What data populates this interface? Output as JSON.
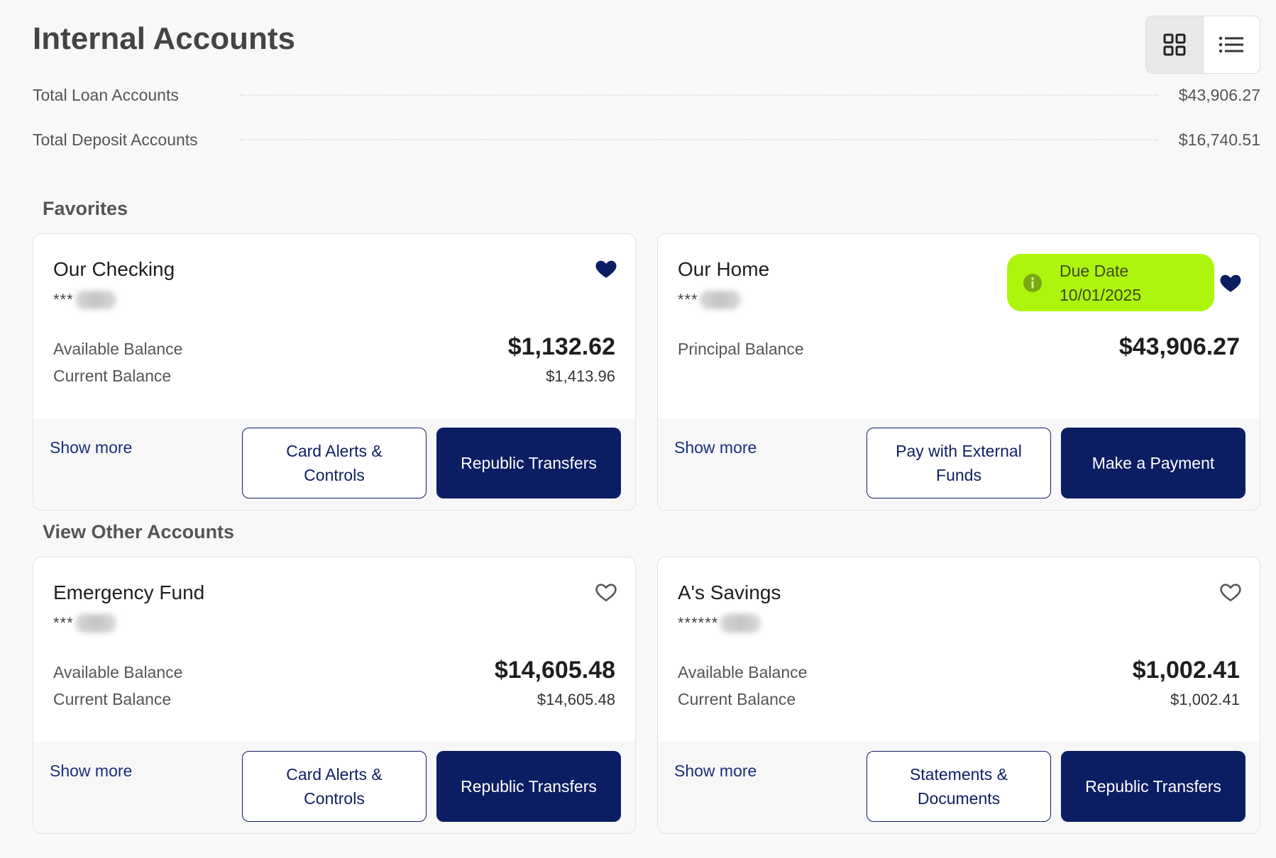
{
  "page": {
    "title": "Internal Accounts"
  },
  "view_toggle": {
    "grid_icon": "grid-icon",
    "list_icon": "list-icon",
    "active": "grid"
  },
  "summary": {
    "loan_label": "Total Loan Accounts",
    "loan_value": "$43,906.27",
    "deposit_label": "Total Deposit Accounts",
    "deposit_value": "$16,740.51"
  },
  "favorites": {
    "title": "Favorites",
    "cards": [
      {
        "name": "Our Checking",
        "mask": "***",
        "favorite": true,
        "primary_label": "Available Balance",
        "primary_value": "$1,132.62",
        "secondary_label": "Current Balance",
        "secondary_value": "$1,413.96",
        "show_more": "Show more",
        "outline_button": "Card Alerts & Controls",
        "solid_button": "Republic Transfers"
      },
      {
        "name": "Our Home",
        "mask": "***",
        "favorite": true,
        "due_label": "Due Date",
        "due_date": "10/01/2025",
        "primary_label": "Principal Balance",
        "primary_value": "$43,906.27",
        "show_more": "Show more",
        "outline_button": "Pay with External Funds",
        "solid_button": "Make a Payment"
      }
    ]
  },
  "other": {
    "title": "View Other Accounts",
    "cards": [
      {
        "name": "Emergency Fund",
        "mask": "***",
        "favorite": false,
        "primary_label": "Available Balance",
        "primary_value": "$14,605.48",
        "secondary_label": "Current Balance",
        "secondary_value": "$14,605.48",
        "show_more": "Show more",
        "outline_button": "Card Alerts & Controls",
        "solid_button": "Republic Transfers"
      },
      {
        "name": "A's Savings",
        "mask": "******",
        "favorite": false,
        "primary_label": "Available Balance",
        "primary_value": "$1,002.41",
        "secondary_label": "Current Balance",
        "secondary_value": "$1,002.41",
        "show_more": "Show more",
        "outline_button": "Statements & Documents",
        "solid_button": "Republic Transfers"
      }
    ]
  },
  "colors": {
    "navy": "#0b1e63",
    "due_badge": "#aef50e",
    "link": "#1a2f7a"
  }
}
